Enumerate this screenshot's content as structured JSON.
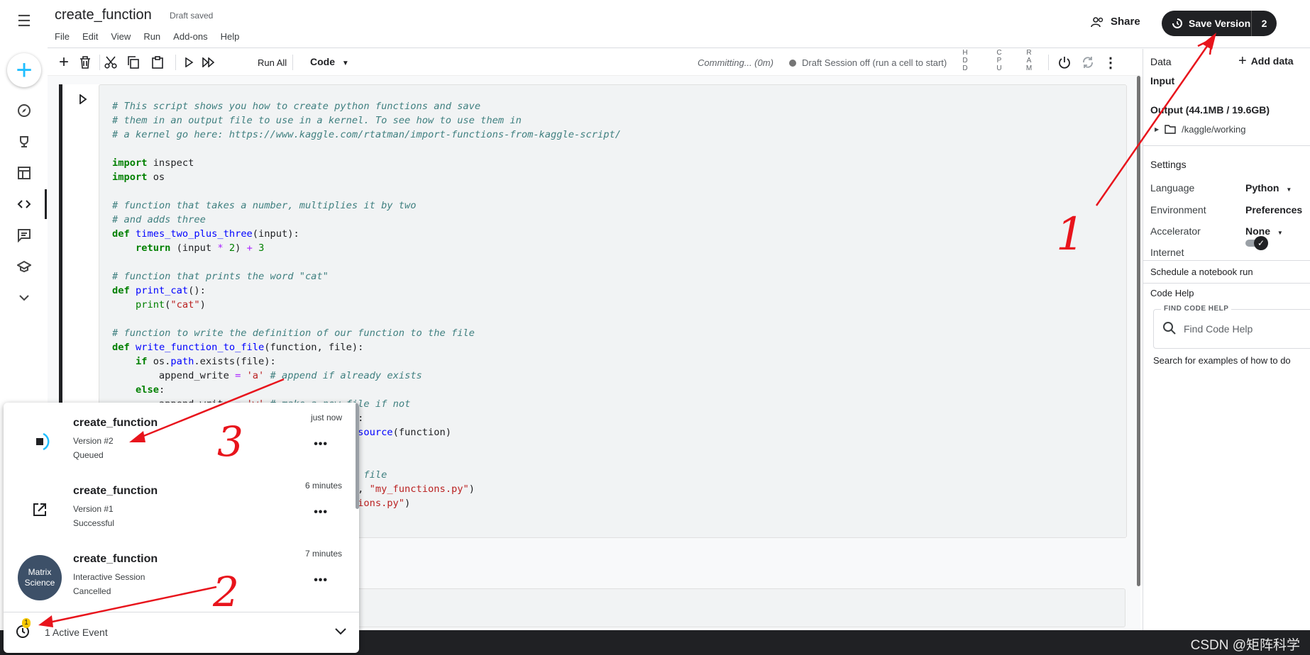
{
  "header": {
    "title": "create_function",
    "draft_status": "Draft saved",
    "menu": [
      "File",
      "Edit",
      "View",
      "Run",
      "Add-ons",
      "Help"
    ],
    "share_label": "Share",
    "save_label": "Save Version",
    "save_count": "2"
  },
  "toolbar": {
    "run_all_label": "Run All",
    "cell_type": "Code",
    "committing": "Committing...  (0m)",
    "session": "Draft Session off (run a cell to start)",
    "resources": [
      "H D D",
      "C P U",
      "R A M"
    ]
  },
  "right_panel": {
    "data_label": "Data",
    "add_data_label": "Add data",
    "input_label": "Input",
    "output_label": "Output (44.1MB / 19.6GB)",
    "output_folder": "/kaggle/working",
    "settings_label": "Settings",
    "language_label": "Language",
    "language_value": "Python",
    "environment_label": "Environment",
    "environment_value": "Preferences",
    "accelerator_label": "Accelerator",
    "accelerator_value": "None",
    "internet_label": "Internet",
    "internet_on": true,
    "schedule_label": "Schedule a notebook run",
    "code_help_label": "Code Help",
    "find_code_help_label": "FIND CODE HELP",
    "find_code_help_placeholder": "Find Code Help",
    "search_examples": "Search for examples of how to do"
  },
  "events": {
    "items": [
      {
        "title": "create_function",
        "subtitle": "Version #2",
        "status": "Queued",
        "time": "just now",
        "icon": "queued-icon"
      },
      {
        "title": "create_function",
        "subtitle": "Version #1",
        "status": "Successful",
        "time": "6 minutes",
        "icon": "open-external-icon"
      },
      {
        "title": "create_function",
        "subtitle": "Interactive Session",
        "status": "Cancelled",
        "time": "7 minutes",
        "icon": "avatar",
        "avatar_text": "Matrix Science"
      }
    ],
    "footer_label": "1 Active Event",
    "footer_badge": "1"
  },
  "annotations": {
    "labels": [
      "1",
      "2",
      "3"
    ],
    "color": "#e8141c"
  },
  "watermark": "CSDN @矩阵科学",
  "colors": {
    "accent": "#20beff",
    "dark": "#202124",
    "annotation": "#e8141c"
  }
}
